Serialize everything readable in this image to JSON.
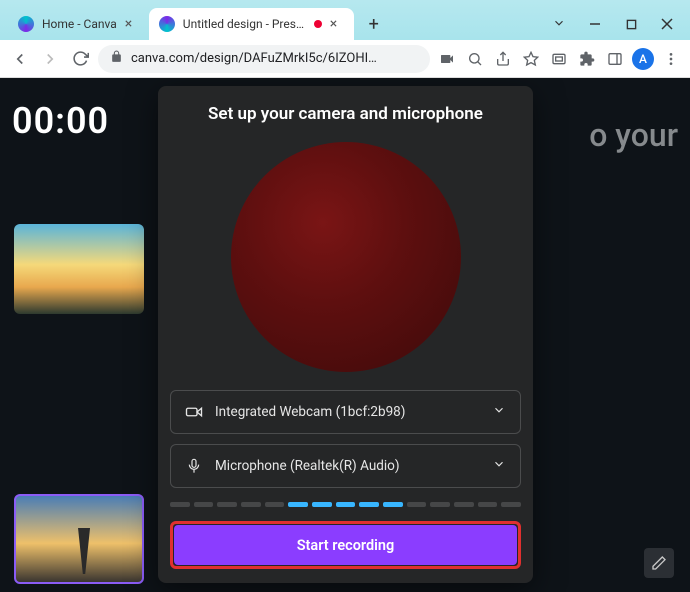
{
  "window": {
    "tabs": [
      {
        "title": "Home - Canva",
        "favicon_color": "#00c4cc",
        "active": false
      },
      {
        "title": "Untitled design - Presen",
        "favicon_color": "#7d2ae8",
        "active": true,
        "recording": true
      }
    ]
  },
  "toolbar": {
    "url": "canva.com/design/DAFuZMrkI5c/6IZOHI…",
    "profile_initial": "A"
  },
  "background": {
    "timer": "00:00",
    "partial_text": "o your"
  },
  "modal": {
    "title": "Set up your camera and microphone",
    "camera_label": "Integrated Webcam (1bcf:2b98)",
    "mic_label": "Microphone (Realtek(R) Audio)",
    "meter_levels": [
      false,
      false,
      false,
      false,
      false,
      true,
      true,
      true,
      true,
      true,
      false,
      false,
      false,
      false,
      false
    ],
    "start_label": "Start recording"
  }
}
